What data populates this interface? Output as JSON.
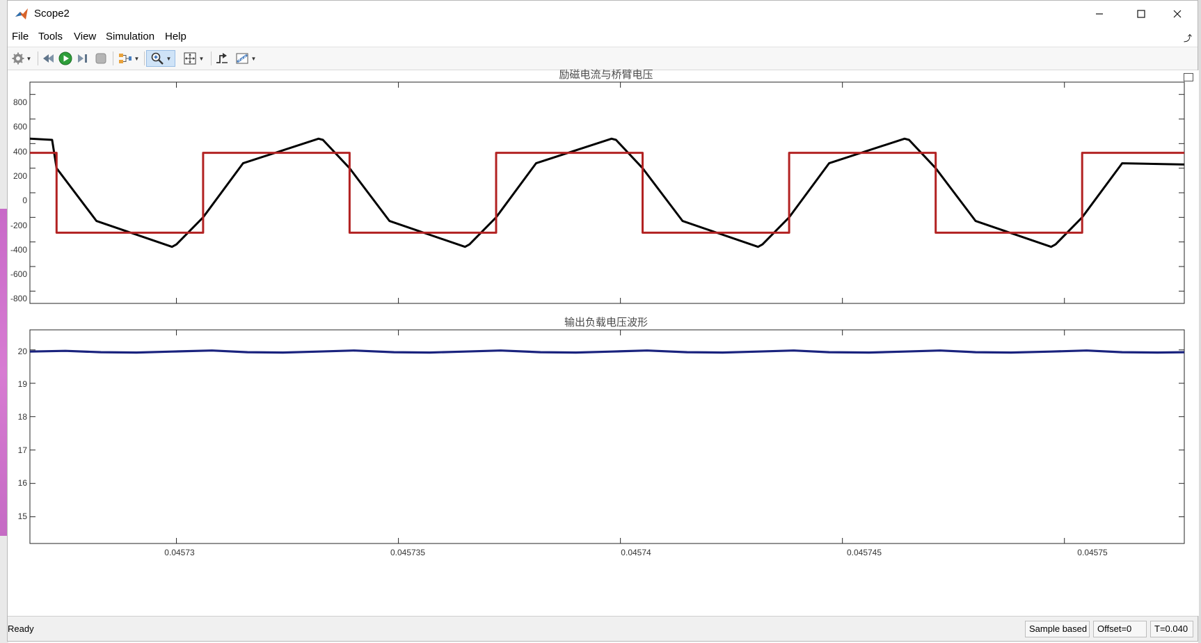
{
  "window": {
    "title": "Scope2"
  },
  "menu": [
    "File",
    "Tools",
    "View",
    "Simulation",
    "Help"
  ],
  "toolbar": [
    "settings-icon",
    "step-back-icon",
    "run-icon",
    "step-forward-icon",
    "stop-icon",
    "signal-selector-icon",
    "zoom-icon",
    "fit-view-icon",
    "triggers-icon",
    "measurements-icon"
  ],
  "plots": [
    {
      "title": "励磁电流与桥臂电压",
      "yticks": [
        "800",
        "600",
        "400",
        "200",
        "0",
        "-200",
        "-400",
        "-600",
        "-800"
      ]
    },
    {
      "title": "输出负载电压波形",
      "yticks": [
        "20",
        "19",
        "18",
        "17",
        "16",
        "15"
      ]
    }
  ],
  "xticks": [
    "0.04573",
    "0.045735",
    "0.04574",
    "0.045745",
    "0.04575"
  ],
  "status": {
    "ready": "Ready",
    "mode": "Sample based",
    "offset": "Offset=0",
    "time": "T=0.040"
  },
  "chart_data": [
    {
      "type": "line",
      "title": "励磁电流与桥臂电压",
      "xlabel": "",
      "ylabel": "",
      "xlim": [
        0.0457267,
        0.0457527
      ],
      "ylim": [
        -900,
        900
      ],
      "grid": false,
      "series": [
        {
          "color": "#000000",
          "x": [
            0.0457267,
            0.0457272,
            0.0457273,
            0.0457282,
            0.0457299,
            0.04573,
            0.0457306,
            0.0457315,
            0.0457332,
            0.0457333,
            0.0457339,
            0.0457348,
            0.0457365,
            0.0457366,
            0.0457372,
            0.0457381,
            0.0457398,
            0.0457399,
            0.0457405,
            0.0457414,
            0.0457431,
            0.0457432,
            0.0457438,
            0.0457447,
            0.0457464,
            0.0457465,
            0.0457471,
            0.045748,
            0.0457497,
            0.0457498,
            0.0457504,
            0.0457513,
            0.0457527
          ],
          "y": [
            440,
            430,
            200,
            -230,
            -440,
            -420,
            -200,
            240,
            440,
            430,
            200,
            -230,
            -440,
            -420,
            -200,
            240,
            440,
            430,
            200,
            -230,
            -440,
            -420,
            -200,
            240,
            440,
            430,
            200,
            -230,
            -440,
            -420,
            -200,
            240,
            230
          ]
        },
        {
          "color": "#b22222",
          "x": [
            0.0457267,
            0.0457273,
            0.0457273,
            0.0457306,
            0.0457306,
            0.0457339,
            0.0457339,
            0.0457372,
            0.0457372,
            0.0457405,
            0.0457405,
            0.0457438,
            0.0457438,
            0.0457471,
            0.0457471,
            0.0457504,
            0.0457504,
            0.0457527
          ],
          "y": [
            325,
            325,
            -325,
            -325,
            325,
            325,
            -325,
            -325,
            325,
            325,
            -325,
            -325,
            325,
            325,
            -325,
            -325,
            325,
            325
          ]
        }
      ]
    },
    {
      "type": "line",
      "title": "输出负载电压波形",
      "xlabel": "",
      "ylabel": "",
      "xlim": [
        0.0457267,
        0.0457527
      ],
      "ylim": [
        14.2,
        20.6
      ],
      "grid": false,
      "series": [
        {
          "color": "#1a237e",
          "x": [
            0.0457267,
            0.0457275,
            0.0457283,
            0.0457291,
            0.0457299,
            0.0457308,
            0.0457316,
            0.0457324,
            0.0457332,
            0.045734,
            0.0457349,
            0.0457357,
            0.0457365,
            0.0457373,
            0.0457382,
            0.045739,
            0.0457398,
            0.0457406,
            0.0457415,
            0.0457423,
            0.0457431,
            0.0457439,
            0.0457447,
            0.0457456,
            0.0457464,
            0.0457472,
            0.045748,
            0.0457488,
            0.0457497,
            0.0457505,
            0.0457513,
            0.0457521,
            0.0457527
          ],
          "y": [
            19.95,
            19.97,
            19.93,
            19.92,
            19.95,
            19.98,
            19.93,
            19.92,
            19.95,
            19.98,
            19.93,
            19.92,
            19.95,
            19.98,
            19.93,
            19.92,
            19.95,
            19.98,
            19.93,
            19.92,
            19.95,
            19.98,
            19.93,
            19.92,
            19.95,
            19.98,
            19.93,
            19.92,
            19.95,
            19.98,
            19.93,
            19.92,
            19.93
          ]
        }
      ]
    }
  ]
}
